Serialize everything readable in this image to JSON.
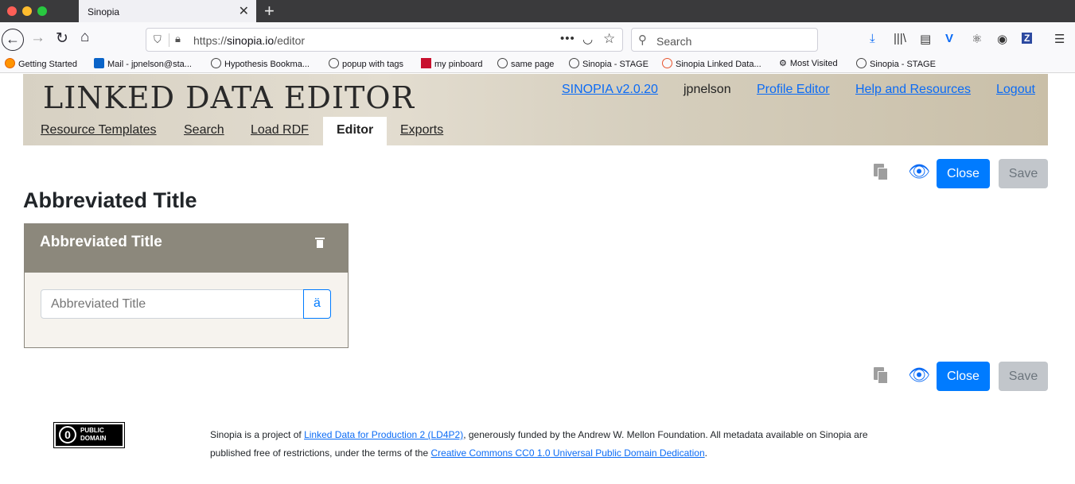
{
  "browser": {
    "tab_title": "Sinopia",
    "url_prefix": "https://",
    "url_host": "sinopia.io",
    "url_path": "/editor",
    "search_placeholder": "Search",
    "bookmarks": [
      "Getting Started",
      "Mail - jpnelson@sta...",
      "Hypothesis Bookma...",
      "popup with tags",
      "my pinboard",
      "same page",
      "Sinopia - STAGE",
      "Sinopia Linked Data...",
      "Most Visited",
      "Sinopia - STAGE"
    ]
  },
  "header": {
    "title": "LINKED DATA EDITOR",
    "version_link": "SINOPIA v2.0.20",
    "username": "jpnelson",
    "profile_editor": "Profile Editor",
    "help": "Help and Resources",
    "logout": "Logout",
    "tabs": [
      "Resource Templates",
      "Search",
      "Load RDF",
      "Editor",
      "Exports"
    ],
    "active_tab": "Editor"
  },
  "actions": {
    "close_label": "Close",
    "save_label": "Save"
  },
  "page_title": "Abbreviated Title",
  "panel": {
    "title": "Abbreviated Title",
    "input_placeholder": "Abbreviated Title",
    "lang_button": "ä"
  },
  "footer": {
    "badge_line1": "PUBLIC",
    "badge_line2": "DOMAIN",
    "text1": "Sinopia is a project of ",
    "link1": "Linked Data for Production 2 (LD4P2)",
    "text2": ", generously funded by the Andrew W. Mellon Foundation. All metadata available on Sinopia are published free of restrictions, under the terms of the ",
    "link2": "Creative Commons CC0 1.0 Universal Public Domain Dedication",
    "text3": "."
  }
}
